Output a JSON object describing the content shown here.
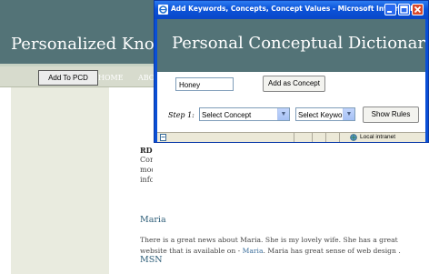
{
  "background_page": {
    "site_title": "Personalized Knowle",
    "add_button": "Add To PCD",
    "nav": [
      "HOME",
      "ABO"
    ],
    "peek_lines": [
      "RDF",
      "Con",
      "mod",
      "info"
    ],
    "posts": [
      {
        "heading": "Maria",
        "text_before": "There is a great news about Maria. She is my lovely wife. She has a great website that is available on - ",
        "link": "Maria",
        "text_after": ". Maria has great sense of web design ."
      },
      {
        "heading": "MSN"
      }
    ]
  },
  "popup": {
    "window_title": "Add Keywords, Concepts, Concept Values - Microsoft Internet E...",
    "heading": "Personal Conceptual Dictionary (PCD)",
    "concept_input_value": "Honey",
    "add_concept_button": "Add as Concept",
    "step_label": "Step 1:",
    "select_concept": "Select Concept",
    "select_keyword": "Select Keyword",
    "show_rules_button": "Show Rules",
    "status_zone": "Local intranet"
  }
}
